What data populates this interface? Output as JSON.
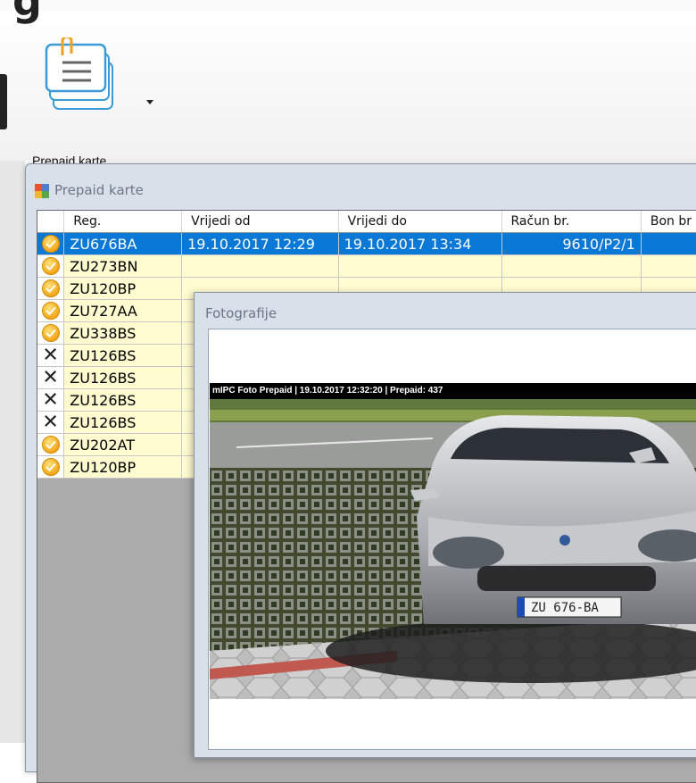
{
  "ribbon": {
    "button_label": "Prepaid karte",
    "icon": "prepaid-card-icon"
  },
  "window": {
    "title": "Prepaid karte",
    "icon": "form-window-icon"
  },
  "grid": {
    "columns": [
      "Reg.",
      "Vrijedi od",
      "Vrijedi do",
      "Račun br.",
      "Bon br"
    ],
    "rows": [
      {
        "status": "ok",
        "reg": "ZU676BA",
        "od": "19.10.2017 12:29",
        "do": "19.10.2017 13:34",
        "racun": "9610/P2/1",
        "bon": ""
      },
      {
        "status": "ok",
        "reg": "ZU273BN",
        "od": "",
        "do": "",
        "racun": "",
        "bon": ""
      },
      {
        "status": "ok",
        "reg": "ZU120BP",
        "od": "",
        "do": "",
        "racun": "",
        "bon": ""
      },
      {
        "status": "ok",
        "reg": "ZU727AA",
        "od": "",
        "do": "",
        "racun": "",
        "bon": ""
      },
      {
        "status": "ok",
        "reg": "ZU338BS",
        "od": "",
        "do": "",
        "racun": "",
        "bon": ""
      },
      {
        "status": "x",
        "reg": "ZU126BS",
        "od": "",
        "do": "",
        "racun": "",
        "bon": ""
      },
      {
        "status": "x",
        "reg": "ZU126BS",
        "od": "",
        "do": "",
        "racun": "",
        "bon": ""
      },
      {
        "status": "x",
        "reg": "ZU126BS",
        "od": "",
        "do": "",
        "racun": "",
        "bon": ""
      },
      {
        "status": "x",
        "reg": "ZU126BS",
        "od": "",
        "do": "",
        "racun": "",
        "bon": ""
      },
      {
        "status": "ok",
        "reg": "ZU202AT",
        "od": "",
        "do": "",
        "racun": "",
        "bon": ""
      },
      {
        "status": "ok",
        "reg": "ZU120BP",
        "od": "",
        "do": "",
        "racun": "",
        "bon": ""
      }
    ]
  },
  "photo_dialog": {
    "title": "Fotografije",
    "overlay_text": "mIPC Foto Prepaid | 19.10.2017 12:32:20 | Prepaid: 437",
    "plate_text": "ZU 676-BA"
  },
  "colors": {
    "selection": "#0a78d7",
    "row_bg": "#fffccf",
    "frame_bg": "#d8e0ea"
  }
}
